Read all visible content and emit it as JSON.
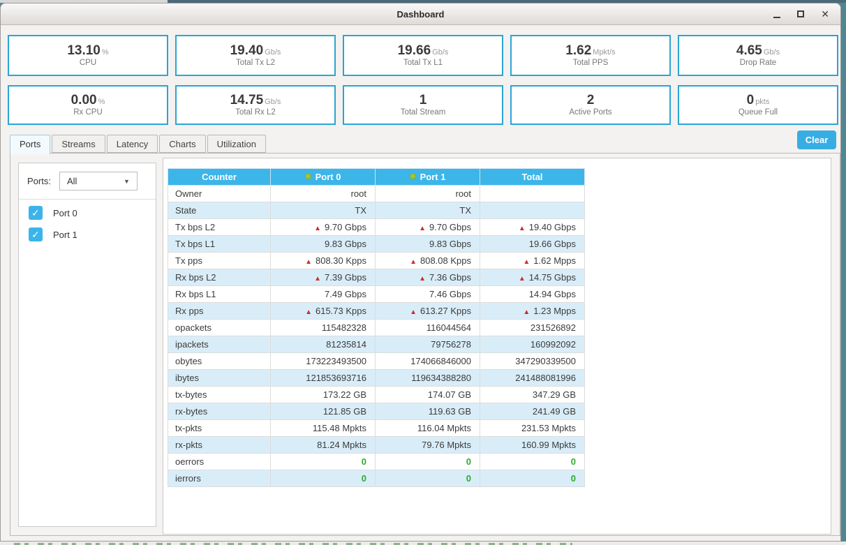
{
  "window": {
    "title": "Dashboard"
  },
  "stats": {
    "row1": [
      {
        "value": "13.10",
        "unit": "%",
        "label": "CPU"
      },
      {
        "value": "19.40",
        "unit": "Gb/s",
        "label": "Total Tx L2"
      },
      {
        "value": "19.66",
        "unit": "Gb/s",
        "label": "Total Tx L1"
      },
      {
        "value": "1.62",
        "unit": "Mpkt/s",
        "label": "Total PPS"
      },
      {
        "value": "4.65",
        "unit": "Gb/s",
        "label": "Drop Rate"
      }
    ],
    "row2": [
      {
        "value": "0.00",
        "unit": "%",
        "label": "Rx CPU"
      },
      {
        "value": "14.75",
        "unit": "Gb/s",
        "label": "Total Rx L2"
      },
      {
        "value": "1",
        "unit": "",
        "label": "Total Stream"
      },
      {
        "value": "2",
        "unit": "",
        "label": "Active Ports"
      },
      {
        "value": "0",
        "unit": "pkts",
        "label": "Queue Full"
      }
    ]
  },
  "tabs": {
    "items": [
      {
        "label": "Ports",
        "active": true
      },
      {
        "label": "Streams",
        "active": false
      },
      {
        "label": "Latency",
        "active": false
      },
      {
        "label": "Charts",
        "active": false
      },
      {
        "label": "Utilization",
        "active": false
      }
    ]
  },
  "toolbar": {
    "clear_label": "Clear"
  },
  "ports_panel": {
    "label": "Ports:",
    "dropdown_value": "All",
    "checkboxes": [
      {
        "label": "Port 0",
        "checked": true
      },
      {
        "label": "Port 1",
        "checked": true
      }
    ]
  },
  "table": {
    "columns": [
      {
        "label": "Counter",
        "dot": false
      },
      {
        "label": "Port 0",
        "dot": true
      },
      {
        "label": "Port 1",
        "dot": true
      },
      {
        "label": "Total",
        "dot": false
      }
    ],
    "status_dot_color": "#9bc53d",
    "rows": [
      {
        "counter": "Owner",
        "values": [
          "root",
          "root",
          ""
        ],
        "style": "plain"
      },
      {
        "counter": "State",
        "values": [
          "TX",
          "TX",
          ""
        ],
        "style": "plain"
      },
      {
        "counter": "Tx bps L2",
        "values": [
          "9.70 Gbps",
          "9.70 Gbps",
          "19.40 Gbps"
        ],
        "style": "arrow"
      },
      {
        "counter": "Tx bps L1",
        "values": [
          "9.83 Gbps",
          "9.83 Gbps",
          "19.66 Gbps"
        ],
        "style": "plain"
      },
      {
        "counter": "Tx pps",
        "values": [
          "808.30 Kpps",
          "808.08 Kpps",
          "1.62 Mpps"
        ],
        "style": "arrow"
      },
      {
        "counter": "Rx bps L2",
        "values": [
          "7.39 Gbps",
          "7.36 Gbps",
          "14.75 Gbps"
        ],
        "style": "arrow"
      },
      {
        "counter": "Rx bps L1",
        "values": [
          "7.49 Gbps",
          "7.46 Gbps",
          "14.94 Gbps"
        ],
        "style": "plain"
      },
      {
        "counter": "Rx pps",
        "values": [
          "615.73 Kpps",
          "613.27 Kpps",
          "1.23 Mpps"
        ],
        "style": "arrow"
      },
      {
        "counter": "opackets",
        "values": [
          "115482328",
          "116044564",
          "231526892"
        ],
        "style": "plain"
      },
      {
        "counter": "ipackets",
        "values": [
          "81235814",
          "79756278",
          "160992092"
        ],
        "style": "plain"
      },
      {
        "counter": "obytes",
        "values": [
          "173223493500",
          "174066846000",
          "347290339500"
        ],
        "style": "plain"
      },
      {
        "counter": "ibytes",
        "values": [
          "121853693716",
          "119634388280",
          "241488081996"
        ],
        "style": "plain"
      },
      {
        "counter": "tx-bytes",
        "values": [
          "173.22 GB",
          "174.07 GB",
          "347.29 GB"
        ],
        "style": "plain"
      },
      {
        "counter": "rx-bytes",
        "values": [
          "121.85 GB",
          "119.63 GB",
          "241.49 GB"
        ],
        "style": "plain"
      },
      {
        "counter": "tx-pkts",
        "values": [
          "115.48 Mpkts",
          "116.04 Mpkts",
          "231.53 Mpkts"
        ],
        "style": "plain"
      },
      {
        "counter": "rx-pkts",
        "values": [
          "81.24 Mpkts",
          "79.76 Mpkts",
          "160.99 Mpkts"
        ],
        "style": "plain"
      },
      {
        "counter": "oerrors",
        "values": [
          "0",
          "0",
          "0"
        ],
        "style": "green"
      },
      {
        "counter": "ierrors",
        "values": [
          "0",
          "0",
          "0"
        ],
        "style": "green"
      }
    ]
  },
  "colors": {
    "accent_blue": "#3cb5e9",
    "card_border": "#2ba4d6",
    "stripe_blue": "#d9edf8",
    "arrow_red": "#c9302c",
    "zero_green": "#2fa832",
    "checkbox_blue": "#3cb4e9"
  }
}
